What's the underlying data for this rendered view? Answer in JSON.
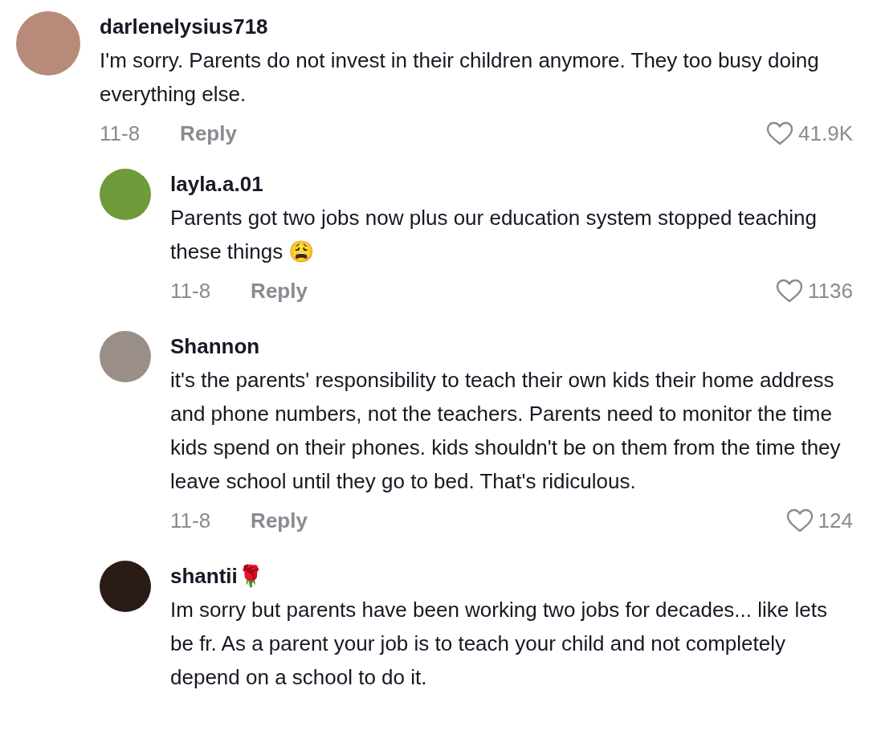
{
  "comments": [
    {
      "username": "darlenelysius718",
      "text": "I'm sorry. Parents do not invest in their children anymore. They too busy doing everything else.",
      "date": "11-8",
      "reply_label": "Reply",
      "likes": "41.9K",
      "replies": [
        {
          "username": "layla.a.01",
          "text": "Parents got two jobs now plus our education system stopped teaching these things 😩",
          "date": "11-8",
          "reply_label": "Reply",
          "likes": "1136"
        },
        {
          "username": "Shannon",
          "text": "it's the parents' responsibility to teach their own kids their home address and phone numbers, not the teachers. Parents need to monitor the time kids spend on their phones. kids shouldn't be on them from the time they leave school until they go to bed. That's ridiculous.",
          "date": "11-8",
          "reply_label": "Reply",
          "likes": "124"
        },
        {
          "username": "shantii🌹",
          "text": "Im sorry but parents have been working two jobs for decades... like lets be fr. As a parent your job is to teach your child and not completely depend on a school to do it."
        }
      ]
    }
  ]
}
